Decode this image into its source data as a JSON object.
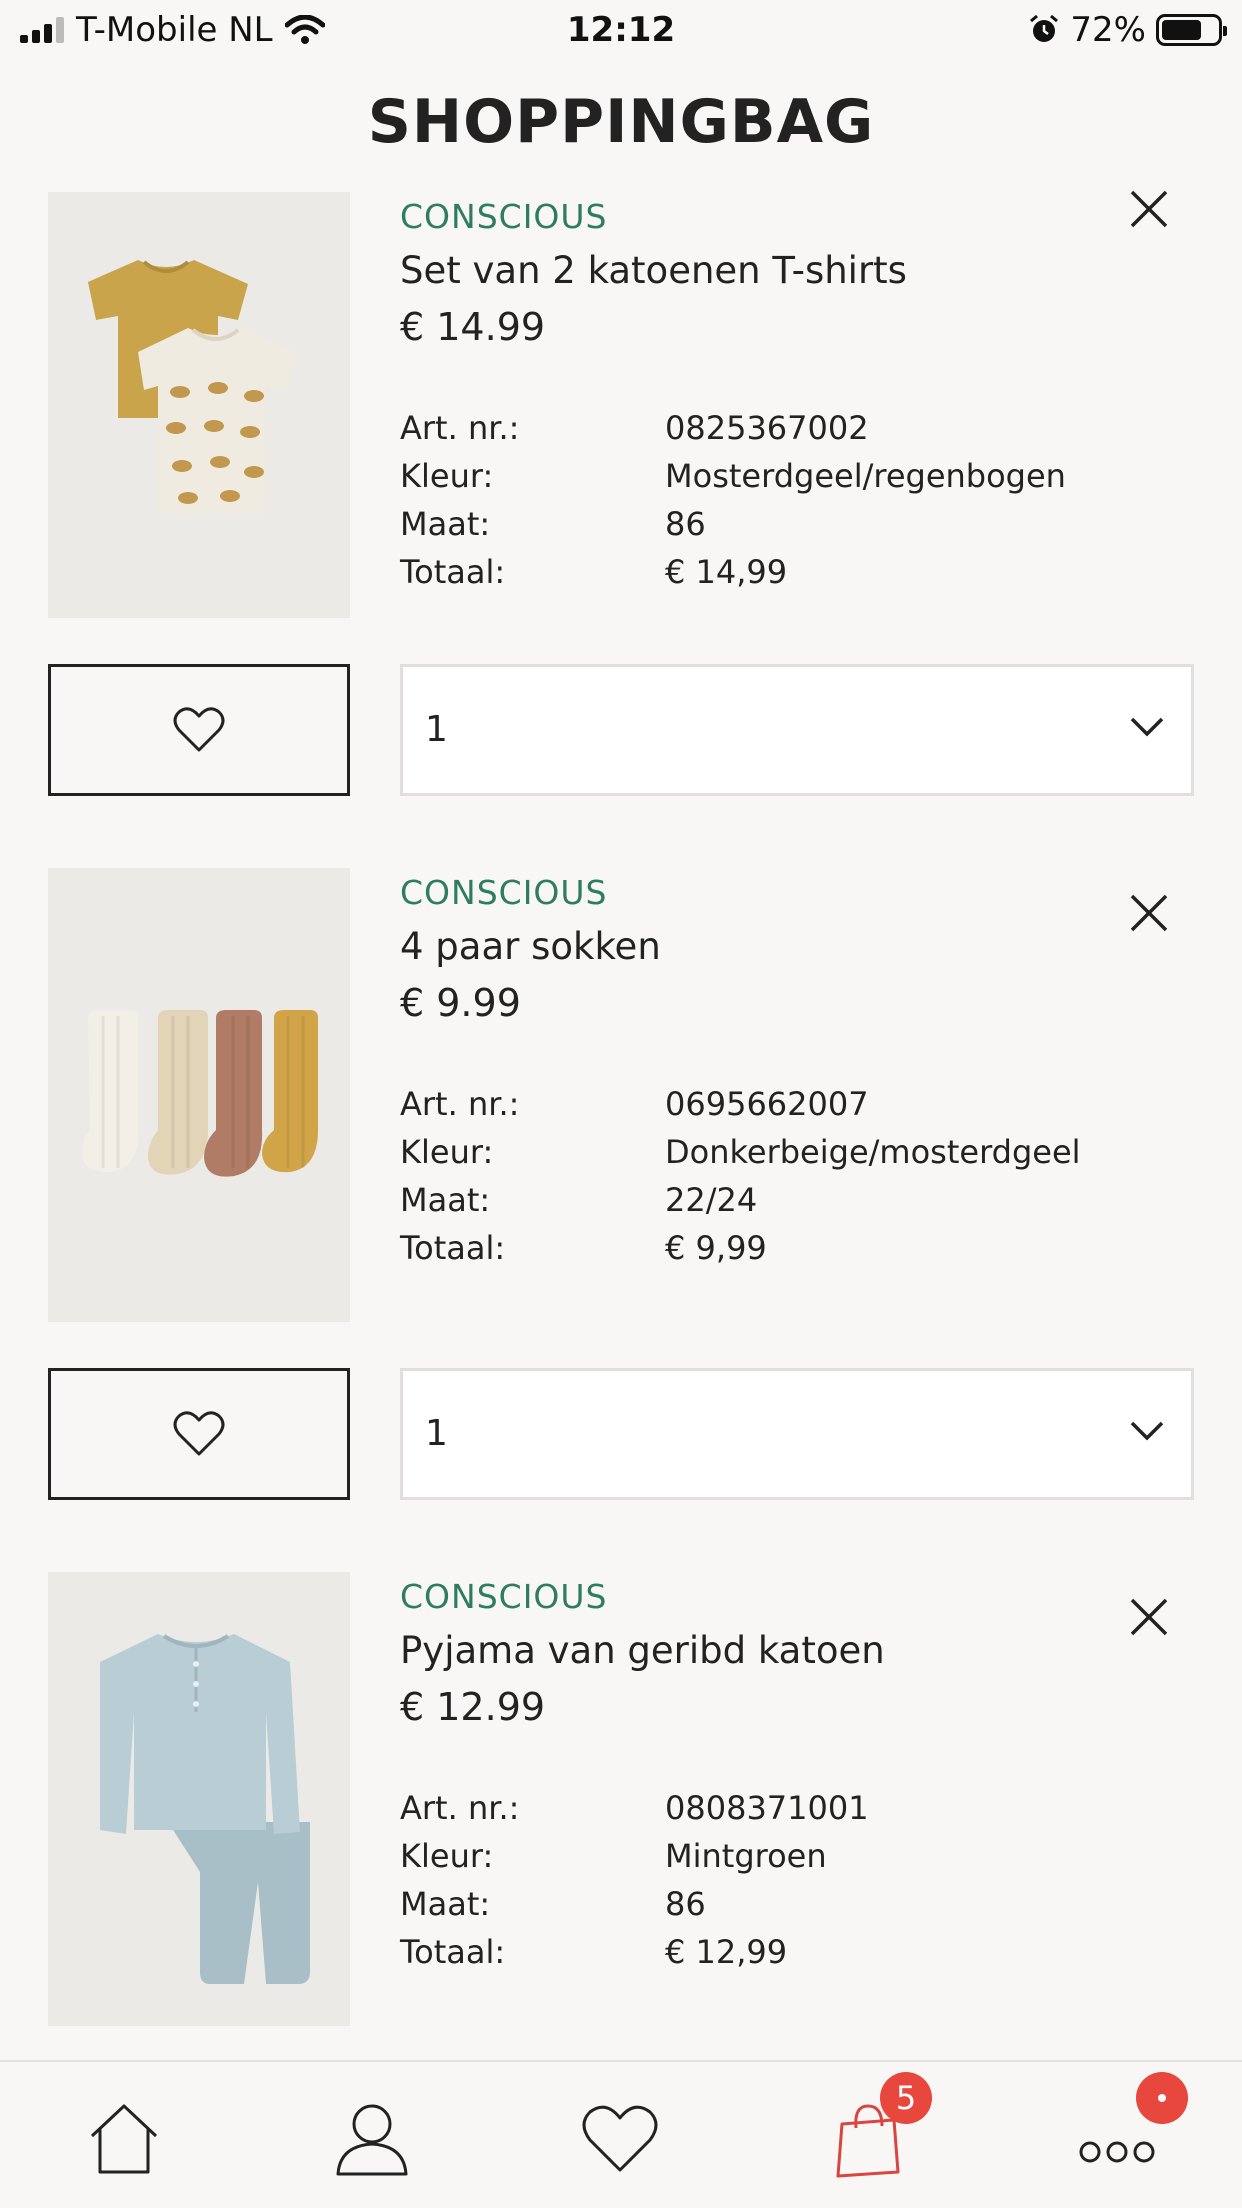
{
  "status_bar": {
    "carrier": "T-Mobile NL",
    "time": "12:12",
    "battery": "72%",
    "battery_level": 0.72
  },
  "header": {
    "title": "SHOPPINGBAG"
  },
  "labels": {
    "art_nr": "Art. nr.:",
    "kleur": "Kleur:",
    "maat": "Maat:",
    "totaal": "Totaal:"
  },
  "items": [
    {
      "tag": "CONSCIOUS",
      "name": "Set van 2 katoenen T-shirts",
      "price": "€ 14.99",
      "art_nr": "0825367002",
      "kleur": "Mosterdgeel/regenbogen",
      "maat": "86",
      "totaal": "€ 14,99",
      "quantity": "1"
    },
    {
      "tag": "CONSCIOUS",
      "name": "4 paar sokken",
      "price": "€ 9.99",
      "art_nr": "0695662007",
      "kleur": "Donkerbeige/mosterdgeel",
      "maat": "22/24",
      "totaal": "€ 9,99",
      "quantity": "1"
    },
    {
      "tag": "CONSCIOUS",
      "name": "Pyjama van geribd katoen",
      "price": "€ 12.99",
      "art_nr": "0808371001",
      "kleur": "Mintgroen",
      "maat": "86",
      "totaal": "€ 12,99",
      "quantity": "1"
    }
  ],
  "bottom_nav": {
    "items": [
      {
        "icon": "home-icon"
      },
      {
        "icon": "account-icon"
      },
      {
        "icon": "favorites-icon"
      },
      {
        "icon": "shopping-bag-icon",
        "badge": "5"
      },
      {
        "icon": "more-icon"
      }
    ]
  },
  "colors": {
    "accent": "#2e7d5e",
    "badge": "#e8473d",
    "bag_active": "#d9453f",
    "background": "#f8f7f5"
  }
}
